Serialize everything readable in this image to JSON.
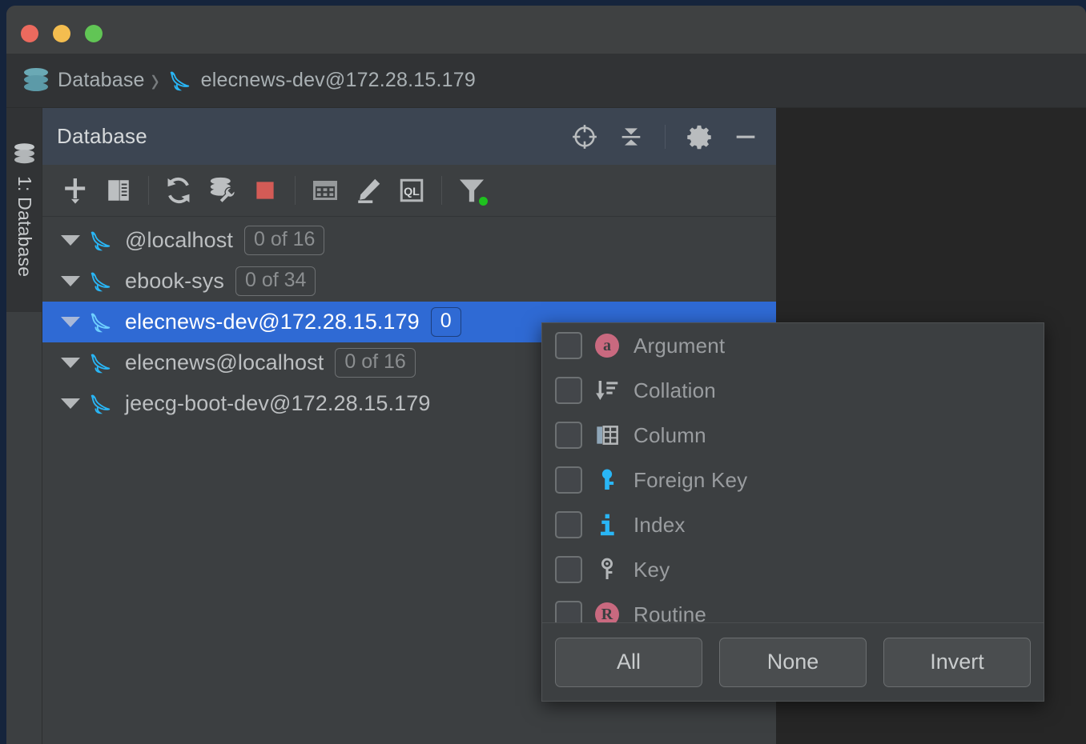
{
  "window": {
    "traffic_lights": [
      {
        "name": "close",
        "color": "#ec6a5e"
      },
      {
        "name": "minimize",
        "color": "#f4bd4f"
      },
      {
        "name": "zoom",
        "color": "#61c555"
      }
    ]
  },
  "breadcrumb": {
    "root_icon": "database-stack-icon",
    "root_label": "Database",
    "separator": "›",
    "leaf_icon": "mysql-dolphin-icon",
    "leaf_label": "elecnews-dev@172.28.15.179"
  },
  "tool_window_stripe": {
    "label": "1: Database",
    "icon": "database-stack-icon"
  },
  "panel": {
    "title": "Database",
    "header_actions": [
      {
        "name": "locate-in-tree",
        "icon": "crosshair-target-icon",
        "tooltip": "Select Opened File"
      },
      {
        "name": "collapse-all",
        "icon": "collapse-all-icon",
        "tooltip": "Collapse All"
      },
      {
        "name": "settings",
        "icon": "gear-icon",
        "tooltip": "Settings"
      },
      {
        "name": "hide",
        "icon": "minimize-dash-icon",
        "tooltip": "Hide"
      }
    ],
    "toolbar_actions": [
      {
        "name": "new",
        "icon": "plus-with-dropdown-icon"
      },
      {
        "name": "duplicate",
        "icon": "copy-pages-icon"
      },
      {
        "name": "refresh",
        "icon": "refresh-sync-icon"
      },
      {
        "name": "data-source-properties",
        "icon": "database-wrench-icon"
      },
      {
        "name": "stop",
        "icon": "stop-square-icon",
        "color": "#d35b56"
      },
      {
        "name": "open-data-editor",
        "icon": "table-grid-icon"
      },
      {
        "name": "modify-object",
        "icon": "pencil-edit-icon"
      },
      {
        "name": "jump-to-query-console",
        "icon": "ql-console-icon"
      },
      {
        "name": "filter",
        "icon": "funnel-filter-icon",
        "active": true,
        "indicator_color": "#1ec11e"
      }
    ]
  },
  "tree": {
    "rows": [
      {
        "label": "@localhost",
        "badge": "0 of 16",
        "expanded": true,
        "selected": false,
        "icon": "mysql-dolphin-icon"
      },
      {
        "label": "ebook-sys",
        "badge": "0 of 34",
        "expanded": true,
        "selected": false,
        "icon": "mysql-dolphin-icon"
      },
      {
        "label": "elecnews-dev@172.28.15.179",
        "badge": "0",
        "expanded": true,
        "selected": true,
        "icon": "mysql-dolphin-icon"
      },
      {
        "label": "elecnews@localhost",
        "badge": "0 of 16",
        "expanded": true,
        "selected": false,
        "icon": "mysql-dolphin-icon"
      },
      {
        "label": "jeecg-boot-dev@172.28.15.179",
        "badge": "",
        "expanded": true,
        "selected": false,
        "icon": "mysql-dolphin-icon"
      }
    ]
  },
  "filter_popup": {
    "items": [
      {
        "label": "Argument",
        "icon": "argument-a-badge-icon",
        "checked": false,
        "glyph": "a",
        "glyph_bg": "#c9697f"
      },
      {
        "label": "Collation",
        "icon": "collation-sort-icon",
        "checked": false
      },
      {
        "label": "Column",
        "icon": "column-table-icon",
        "checked": false
      },
      {
        "label": "Foreign Key",
        "icon": "foreign-key-icon",
        "checked": false
      },
      {
        "label": "Index",
        "icon": "index-info-icon",
        "checked": false
      },
      {
        "label": "Key",
        "icon": "key-icon",
        "checked": false
      },
      {
        "label": "Routine",
        "icon": "routine-r-badge-icon",
        "checked": false,
        "glyph": "R",
        "glyph_bg": "#c9697f"
      }
    ],
    "buttons": [
      {
        "name": "all",
        "label": "All"
      },
      {
        "name": "none",
        "label": "None"
      },
      {
        "name": "invert",
        "label": "Invert"
      }
    ]
  },
  "colors": {
    "window_bg": "#3c3f41",
    "panel_header_bg": "#3c4552",
    "selection_blue": "#2f6ad4",
    "editor_bg": "#262626",
    "desktop_bg": "#15243c",
    "accent_cyan": "#29b6f6",
    "stop_red": "#d35b56",
    "active_green": "#1ec11e"
  }
}
